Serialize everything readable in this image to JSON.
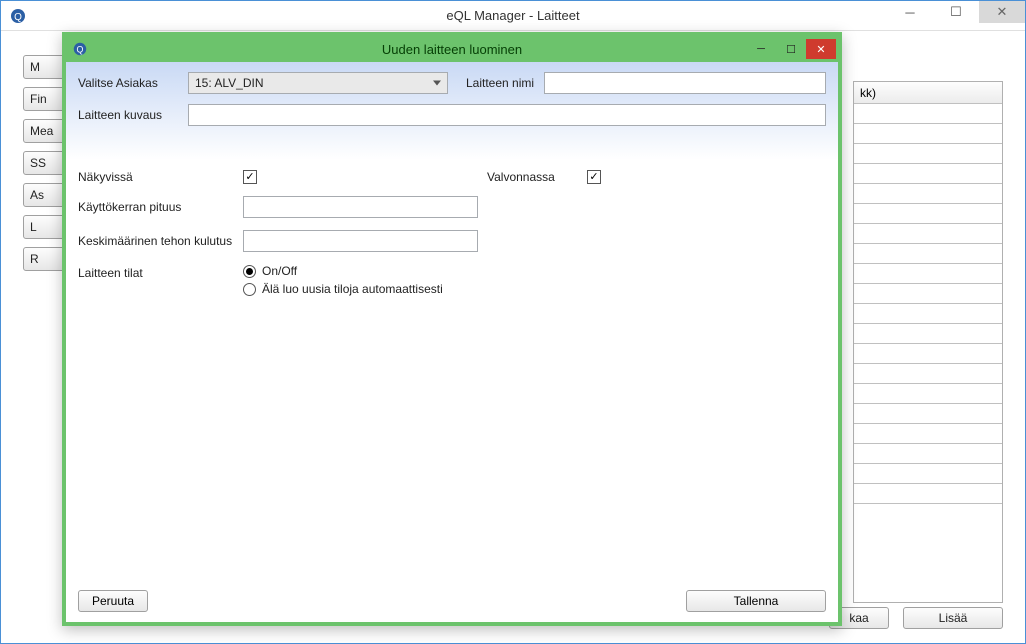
{
  "parent": {
    "title": "eQL Manager - Laitteet",
    "left_buttons": [
      "M",
      "Fin",
      "Mea",
      "SS",
      "As",
      "L",
      "R"
    ],
    "right_header_fragment": "kk)",
    "bottom_fragment_btn": "kaa",
    "bottom_add_btn": "Lisää"
  },
  "dialog": {
    "title": "Uuden laitteen luominen",
    "labels": {
      "valitse_asiakas": "Valitse Asiakas",
      "laitteen_nimi": "Laitteen nimi",
      "laitteen_kuvaus": "Laitteen kuvaus",
      "nakyvissa": "Näkyvissä",
      "valvonnassa": "Valvonnassa",
      "kayttokerran_pituus": "Käyttökerran pituus",
      "keskimaarainen_tehon_kulutus": "Keskimäärinen tehon kulutus",
      "laitteen_tilat": "Laitteen tilat"
    },
    "values": {
      "asiakas_selected": "15: ALV_DIN",
      "laitteen_nimi": "",
      "laitteen_kuvaus": "",
      "nakyvissa_checked": true,
      "valvonnassa_checked": true,
      "kayttokerran_pituus": "",
      "keskimaarainen_tehon_kulutus": "",
      "tila_selected": "onoff"
    },
    "radio_options": {
      "onoff": "On/Off",
      "no_auto": "Älä luo uusia tiloja automaattisesti"
    },
    "buttons": {
      "peruuta": "Peruuta",
      "tallenna": "Tallenna"
    }
  }
}
